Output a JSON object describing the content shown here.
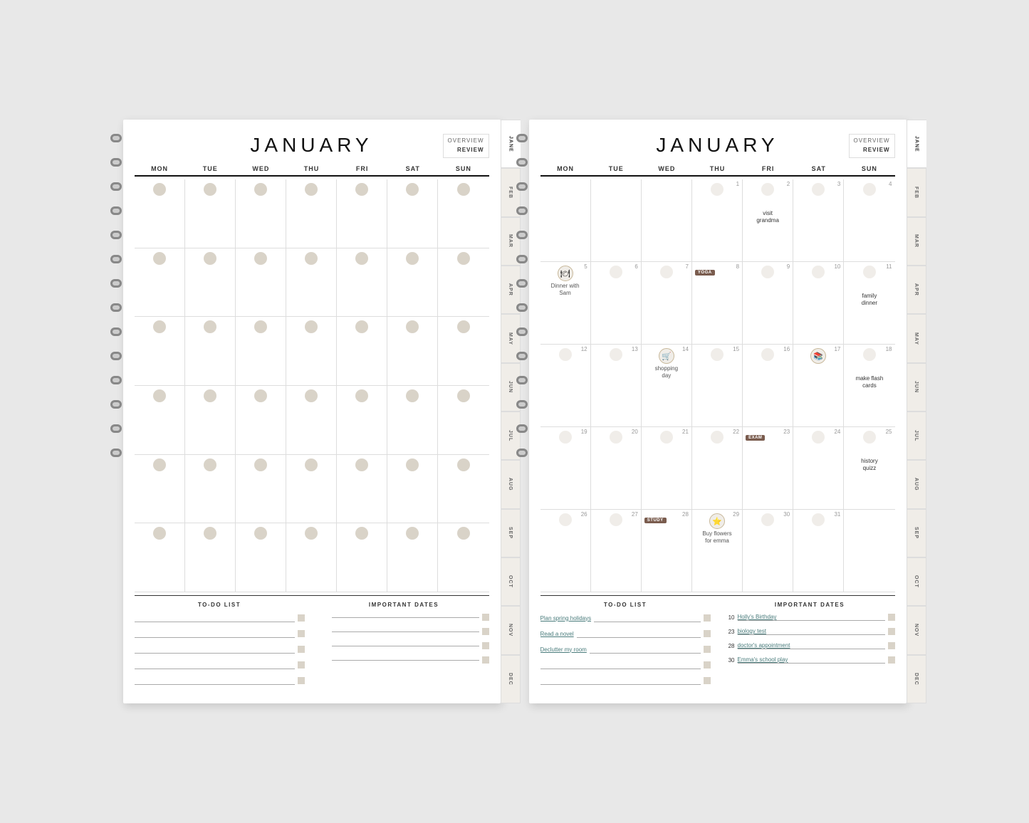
{
  "planners": [
    {
      "id": "blank",
      "month": "JANUARY",
      "nav": {
        "overview": "OVERVIEW",
        "review": "REVIEW"
      },
      "days": [
        "MON",
        "TUE",
        "WED",
        "THU",
        "FRI",
        "SAT",
        "SUN"
      ],
      "weeks": [
        [
          null,
          null,
          null,
          null,
          null,
          null,
          null
        ],
        [
          null,
          null,
          null,
          null,
          null,
          null,
          null
        ],
        [
          null,
          null,
          null,
          null,
          null,
          null,
          null
        ],
        [
          null,
          null,
          null,
          null,
          null,
          null,
          null
        ],
        [
          null,
          null,
          null,
          null,
          null,
          null,
          null
        ],
        [
          null,
          null,
          null,
          null,
          null,
          null,
          null
        ]
      ],
      "todo_title": "TO-DO LIST",
      "important_title": "IMPORTANT DATES",
      "todos": [
        "",
        "",
        "",
        "",
        ""
      ],
      "important": [
        {
          "num": "",
          "text": ""
        },
        {
          "num": "",
          "text": ""
        },
        {
          "num": "",
          "text": ""
        },
        {
          "num": "",
          "text": ""
        }
      ],
      "tabs": [
        "JANE",
        "FEB",
        "MAR",
        "APR",
        "MAY",
        "JUN",
        "JUL",
        "AUG",
        "SEP",
        "OCT",
        "NOV",
        "DEC"
      ]
    },
    {
      "id": "filled",
      "month": "JANUARY",
      "nav": {
        "overview": "OVERVIEW",
        "review": "REVIEW"
      },
      "days": [
        "MON",
        "TUE",
        "WED",
        "THU",
        "FRI",
        "SAT",
        "SUN"
      ],
      "weeks": [
        [
          {
            "num": "",
            "event": "",
            "icon": null,
            "tag": null
          },
          {
            "num": "",
            "event": "",
            "icon": null,
            "tag": null
          },
          {
            "num": "",
            "event": "",
            "icon": null,
            "tag": null
          },
          {
            "num": "1",
            "event": "",
            "icon": null,
            "tag": null
          },
          {
            "num": "2",
            "event": "visit\ngrandma",
            "icon": null,
            "tag": null
          },
          {
            "num": "3",
            "event": "",
            "icon": null,
            "tag": null
          },
          {
            "num": "4",
            "event": "",
            "icon": null,
            "tag": null
          }
        ],
        [
          {
            "num": "5",
            "event": "Dinner with\nSam",
            "icon": "dinner",
            "tag": null
          },
          {
            "num": "6",
            "event": "",
            "icon": null,
            "tag": null
          },
          {
            "num": "7",
            "event": "",
            "icon": null,
            "tag": null
          },
          {
            "num": "8",
            "event": "",
            "icon": null,
            "tag": "yoga"
          },
          {
            "num": "9",
            "event": "",
            "icon": null,
            "tag": null
          },
          {
            "num": "10",
            "event": "",
            "icon": null,
            "tag": null
          },
          {
            "num": "11",
            "event": "family\ndinner",
            "icon": null,
            "tag": null
          }
        ],
        [
          {
            "num": "12",
            "event": "",
            "icon": null,
            "tag": null
          },
          {
            "num": "13",
            "event": "",
            "icon": null,
            "tag": null
          },
          {
            "num": "14",
            "event": "shopping\nday",
            "icon": "shopping",
            "tag": null
          },
          {
            "num": "15",
            "event": "",
            "icon": null,
            "tag": null
          },
          {
            "num": "16",
            "event": "",
            "icon": null,
            "tag": null
          },
          {
            "num": "17",
            "event": "",
            "icon": "school",
            "tag": null
          },
          {
            "num": "18",
            "event": "make flash\ncards",
            "icon": null,
            "tag": null
          }
        ],
        [
          {
            "num": "19",
            "event": "",
            "icon": null,
            "tag": null
          },
          {
            "num": "20",
            "event": "",
            "icon": null,
            "tag": null
          },
          {
            "num": "21",
            "event": "",
            "icon": null,
            "tag": null
          },
          {
            "num": "22",
            "event": "",
            "icon": null,
            "tag": null
          },
          {
            "num": "23",
            "event": "",
            "icon": null,
            "tag": "exam"
          },
          {
            "num": "24",
            "event": "",
            "icon": null,
            "tag": null
          },
          {
            "num": "25",
            "event": "history\nquizz",
            "icon": null,
            "tag": null
          }
        ],
        [
          {
            "num": "26",
            "event": "",
            "icon": null,
            "tag": null
          },
          {
            "num": "27",
            "event": "",
            "icon": null,
            "tag": null
          },
          {
            "num": "28",
            "event": "",
            "icon": null,
            "tag": "study"
          },
          {
            "num": "29",
            "event": "Buy flowers\nfor emma",
            "icon": "star",
            "tag": null
          },
          {
            "num": "30",
            "event": "",
            "icon": null,
            "tag": null
          },
          {
            "num": "31",
            "event": "",
            "icon": null,
            "tag": null
          },
          {
            "num": "",
            "event": "",
            "icon": null,
            "tag": null
          }
        ]
      ],
      "todo_title": "TO-DO LIST",
      "important_title": "IMPORTANT DATES",
      "todos": [
        "Plan spring holidays",
        "Read a novel",
        "Declutter my room",
        "",
        ""
      ],
      "important": [
        {
          "num": "10",
          "text": "Holly's Birthday"
        },
        {
          "num": "23",
          "text": "biology test"
        },
        {
          "num": "28",
          "text": "doctor's appointment"
        },
        {
          "num": "30",
          "text": "Emma's school play"
        }
      ],
      "tabs": [
        "JANE",
        "FEB",
        "MAR",
        "APR",
        "MAY",
        "JUN",
        "JUL",
        "AUG",
        "SEP",
        "OCT",
        "NOV",
        "DEC"
      ]
    }
  ]
}
